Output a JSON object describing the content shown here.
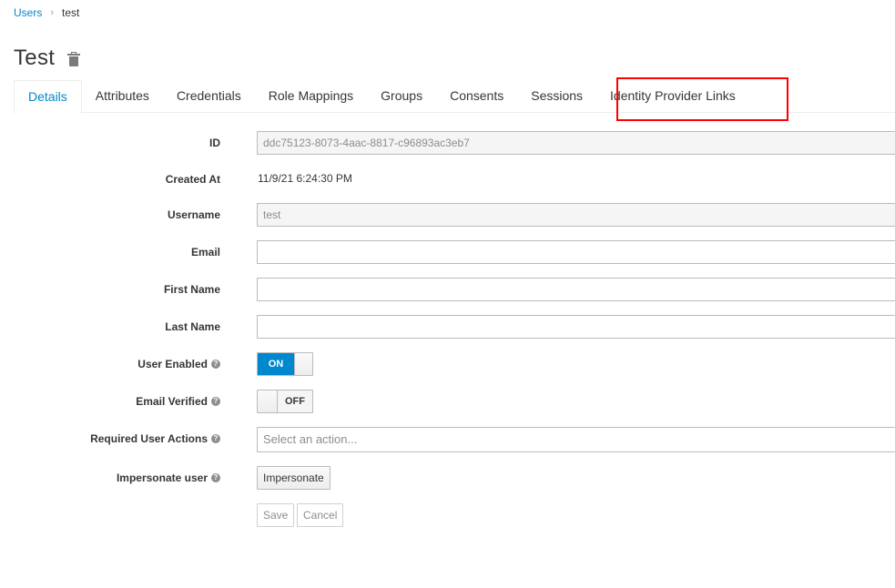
{
  "breadcrumb": {
    "parent": "Users",
    "separator": "›",
    "current": "test"
  },
  "page": {
    "title": "Test",
    "delete_icon": "trash-icon"
  },
  "tabs": [
    {
      "label": "Details",
      "active": true
    },
    {
      "label": "Attributes",
      "active": false
    },
    {
      "label": "Credentials",
      "active": false
    },
    {
      "label": "Role Mappings",
      "active": false
    },
    {
      "label": "Groups",
      "active": false
    },
    {
      "label": "Consents",
      "active": false
    },
    {
      "label": "Sessions",
      "active": false
    },
    {
      "label": "Identity Provider Links",
      "active": false,
      "highlighted": true
    }
  ],
  "highlight_color": "#ff0000",
  "accent_color": "#0088ce",
  "form": {
    "id": {
      "label": "ID",
      "value": "ddc75123-8073-4aac-8817-c96893ac3eb7"
    },
    "created_at": {
      "label": "Created At",
      "value": "11/9/21 6:24:30 PM"
    },
    "username": {
      "label": "Username",
      "value": "test"
    },
    "email": {
      "label": "Email",
      "value": ""
    },
    "first_name": {
      "label": "First Name",
      "value": ""
    },
    "last_name": {
      "label": "Last Name",
      "value": ""
    },
    "user_enabled": {
      "label": "User Enabled",
      "state": "ON",
      "help_icon": "question-circle-icon"
    },
    "email_verified": {
      "label": "Email Verified",
      "state": "OFF",
      "help_icon": "question-circle-icon"
    },
    "required_actions": {
      "label": "Required User Actions",
      "placeholder": "Select an action...",
      "help_icon": "question-circle-icon"
    },
    "impersonate": {
      "label": "Impersonate user",
      "button": "Impersonate",
      "help_icon": "question-circle-icon"
    }
  },
  "actions": {
    "save": "Save",
    "cancel": "Cancel"
  }
}
